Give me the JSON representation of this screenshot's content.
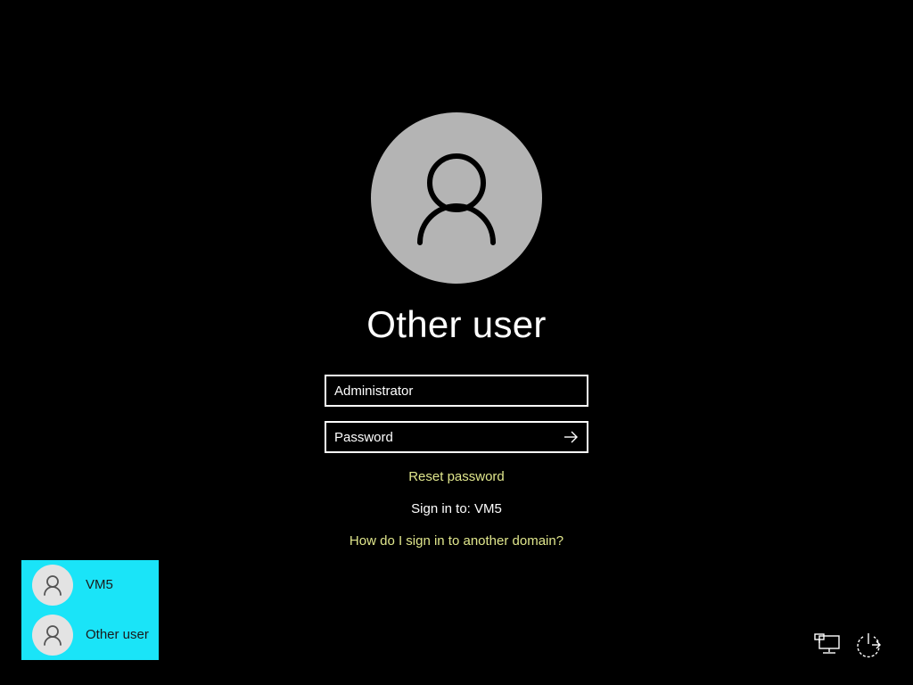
{
  "current_user": {
    "name": "Other user",
    "avatar_icon": "person-icon",
    "avatar_bg": "#b4b4b4"
  },
  "form": {
    "username_value": "Administrator",
    "password_placeholder": "Password",
    "submit_icon": "arrow-right-icon"
  },
  "links": {
    "reset_password": "Reset password",
    "sign_in_to": "Sign in to: VM5",
    "other_domain": "How do I sign in to another domain?",
    "link_color": "#e0e68c"
  },
  "user_switcher": {
    "background": "#1ae4f8",
    "users": [
      {
        "label": "VM5",
        "icon": "person-icon"
      },
      {
        "label": "Other user",
        "icon": "person-icon"
      }
    ]
  },
  "corner_icons": {
    "network": "network-icon",
    "power": "power-icon"
  }
}
